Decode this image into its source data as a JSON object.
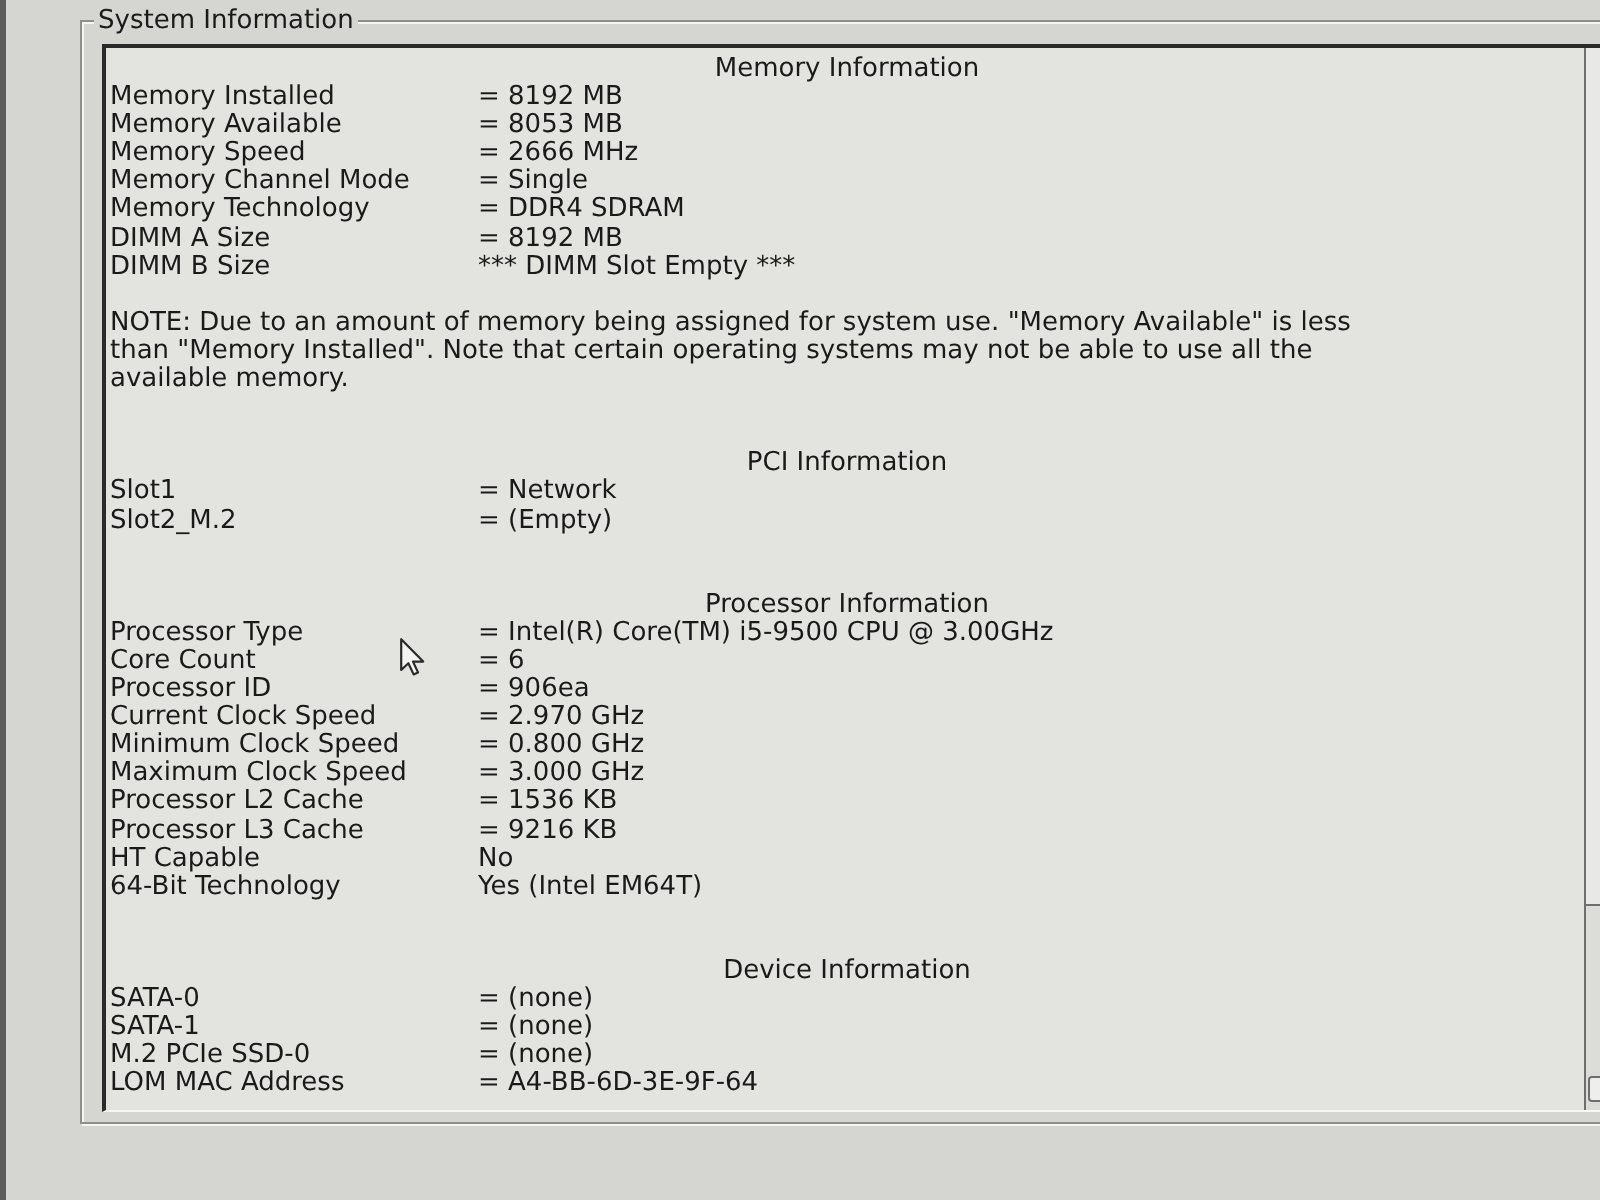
{
  "window": {
    "title": "System Information"
  },
  "sections": [
    {
      "title": "Memory Information",
      "rows": [
        {
          "label": "Memory Installed",
          "value": "= 8192 MB"
        },
        {
          "label": "Memory Available",
          "value": "= 8053 MB"
        },
        {
          "label": "Memory Speed",
          "value": "= 2666 MHz"
        },
        {
          "label": "Memory Channel Mode",
          "value": "= Single"
        },
        {
          "label": "Memory Technology",
          "value": "= DDR4 SDRAM"
        },
        {
          "label": "DIMM A Size",
          "value": "= 8192 MB"
        },
        {
          "label": "DIMM B Size",
          "value": "*** DIMM Slot Empty ***"
        }
      ],
      "note": "NOTE: Due to an amount of memory being assigned for system use. \"Memory Available\" is less than \"Memory Installed\". Note that certain operating systems may not be able to use all the available memory."
    },
    {
      "title": "PCI Information",
      "rows": [
        {
          "label": "Slot1",
          "value": "= Network"
        },
        {
          "label": "Slot2_M.2",
          "value": "= (Empty)"
        }
      ]
    },
    {
      "title": "Processor Information",
      "rows": [
        {
          "label": "Processor Type",
          "value": "= Intel(R) Core(TM) i5-9500 CPU @ 3.00GHz"
        },
        {
          "label": "Core Count",
          "value": "= 6"
        },
        {
          "label": "Processor ID",
          "value": "= 906ea"
        },
        {
          "label": "Current Clock Speed",
          "value": "= 2.970 GHz"
        },
        {
          "label": "Minimum Clock Speed",
          "value": "= 0.800 GHz"
        },
        {
          "label": "Maximum Clock Speed",
          "value": "= 3.000 GHz"
        },
        {
          "label": "Processor L2 Cache",
          "value": "= 1536 KB"
        },
        {
          "label": "Processor L3 Cache",
          "value": "= 9216 KB"
        },
        {
          "label": "HT Capable",
          "value": "No"
        },
        {
          "label": "64-Bit Technology",
          "value": "Yes (Intel EM64T)"
        }
      ]
    },
    {
      "title": "Device Information",
      "rows": [
        {
          "label": "SATA-0",
          "value": "= (none)"
        },
        {
          "label": "SATA-1",
          "value": "= (none)"
        },
        {
          "label": "M.2 PCIe SSD-0",
          "value": "= (none)"
        },
        {
          "label": "LOM MAC Address",
          "value": "= A4-BB-6D-3E-9F-64"
        }
      ]
    }
  ]
}
